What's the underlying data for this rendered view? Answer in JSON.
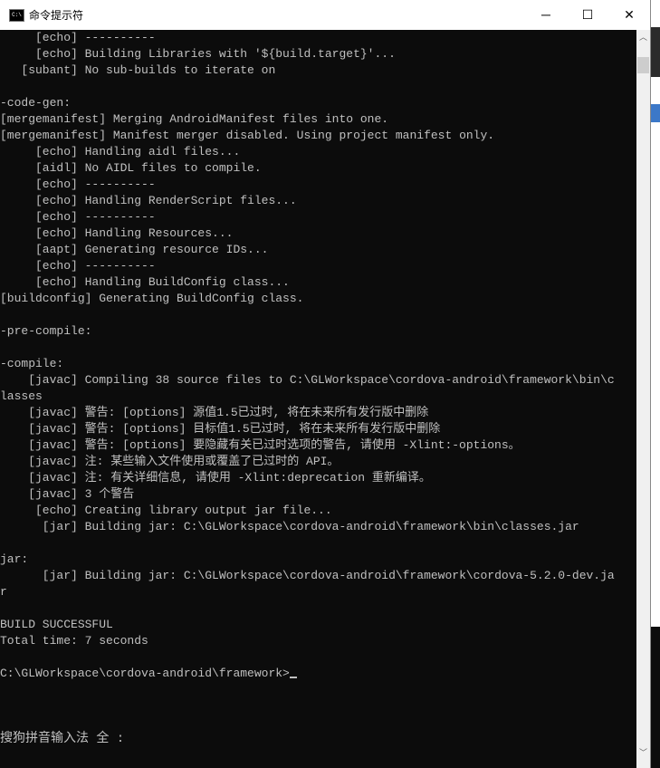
{
  "window": {
    "title": "命令提示符",
    "icon": "cmd-icon",
    "controls": {
      "minimize": "─",
      "maximize": "☐",
      "close": "✕"
    }
  },
  "console": {
    "lines": [
      "     [echo] ----------",
      "     [echo] Building Libraries with '${build.target}'...",
      "   [subant] No sub-builds to iterate on",
      "",
      "-code-gen:",
      "[mergemanifest] Merging AndroidManifest files into one.",
      "[mergemanifest] Manifest merger disabled. Using project manifest only.",
      "     [echo] Handling aidl files...",
      "     [aidl] No AIDL files to compile.",
      "     [echo] ----------",
      "     [echo] Handling RenderScript files...",
      "     [echo] ----------",
      "     [echo] Handling Resources...",
      "     [aapt] Generating resource IDs...",
      "     [echo] ----------",
      "     [echo] Handling BuildConfig class...",
      "[buildconfig] Generating BuildConfig class.",
      "",
      "-pre-compile:",
      "",
      "-compile:",
      "    [javac] Compiling 38 source files to C:\\GLWorkspace\\cordova-android\\framework\\bin\\c",
      "lasses",
      "    [javac] 警告: [options] 源值1.5已过时, 将在未来所有发行版中删除",
      "    [javac] 警告: [options] 目标值1.5已过时, 将在未来所有发行版中删除",
      "    [javac] 警告: [options] 要隐藏有关已过时选项的警告, 请使用 -Xlint:-options。",
      "    [javac] 注: 某些输入文件使用或覆盖了已过时的 API。",
      "    [javac] 注: 有关详细信息, 请使用 -Xlint:deprecation 重新编译。",
      "    [javac] 3 个警告",
      "     [echo] Creating library output jar file...",
      "      [jar] Building jar: C:\\GLWorkspace\\cordova-android\\framework\\bin\\classes.jar",
      "",
      "jar:",
      "      [jar] Building jar: C:\\GLWorkspace\\cordova-android\\framework\\cordova-5.2.0-dev.ja",
      "r",
      "",
      "BUILD SUCCESSFUL",
      "Total time: 7 seconds",
      ""
    ],
    "prompt": "C:\\GLWorkspace\\cordova-android\\framework>",
    "ime_status": "搜狗拼音输入法 全 :"
  },
  "colors": {
    "console_bg": "#0c0c0c",
    "console_fg": "#c0c0c0"
  }
}
